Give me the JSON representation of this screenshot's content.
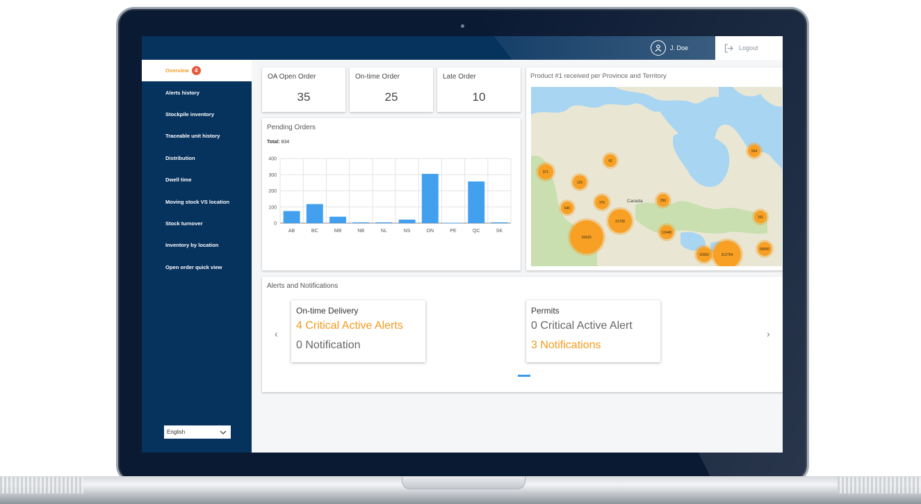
{
  "user": {
    "name": "J. Doe",
    "logout_label": "Logout"
  },
  "sidebar": {
    "items": [
      {
        "label": "Overview",
        "badge": "4",
        "active": true
      },
      {
        "label": "Alerts history"
      },
      {
        "label": "Stockpile inventory"
      },
      {
        "label": "Traceable unit history"
      },
      {
        "label": "Distribution"
      },
      {
        "label": "Dwell time"
      },
      {
        "label": "Moving stock VS location"
      },
      {
        "label": "Stock turnover"
      },
      {
        "label": "Inventory by location"
      },
      {
        "label": "Open order quick view"
      }
    ],
    "language": "English"
  },
  "kpis": [
    {
      "label": "OA Open Order",
      "value": "35"
    },
    {
      "label": "On-time Order",
      "value": "25"
    },
    {
      "label": "Late Order",
      "value": "10"
    }
  ],
  "pending": {
    "title": "Pending Orders",
    "total_label": "Total:",
    "total_value": "834"
  },
  "chart_data": {
    "type": "bar",
    "categories": [
      "AB",
      "BC",
      "MB",
      "NB",
      "NL",
      "NS",
      "ON",
      "PE",
      "QC",
      "SK"
    ],
    "values": [
      75,
      118,
      40,
      5,
      5,
      22,
      305,
      2,
      258,
      5
    ],
    "yticks": [
      0,
      100,
      200,
      300,
      400
    ],
    "ylim": [
      0,
      400
    ],
    "grid": true,
    "color": "#42a0ef"
  },
  "map": {
    "title": "Product #1 received per Province and Territory",
    "country_label": "Canada",
    "clusters": [
      "971",
      "42",
      "504",
      "126",
      "370",
      "260",
      "640",
      "31708",
      "66625",
      "12448",
      "161",
      "16550",
      "312754",
      "58000"
    ]
  },
  "alerts": {
    "title": "Alerts and Notifications",
    "cards": [
      {
        "title": "On-time Delivery",
        "line1": "4 Critical Active Alerts",
        "line1_highlight": true,
        "line2": "0 Notification",
        "line2_highlight": false
      },
      {
        "title": "Permits",
        "line1": "0 Critical Active Alert",
        "line1_highlight": false,
        "line2": "3 Notifications",
        "line2_highlight": true
      }
    ],
    "prev_icon": "chevron-left-icon",
    "next_icon": "chevron-right-icon"
  },
  "colors": {
    "navy": "#06325e",
    "accent": "#f39a1e",
    "bar": "#42a0ef",
    "badge": "#e8583a"
  }
}
